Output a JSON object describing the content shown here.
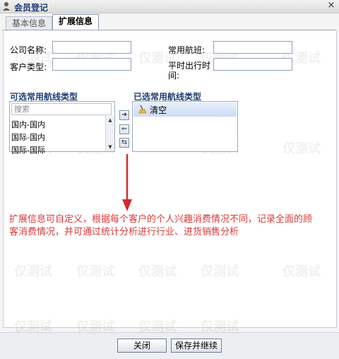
{
  "window": {
    "title": "会员登记",
    "close": "×"
  },
  "tabs": [
    {
      "label": "基本信息"
    },
    {
      "label": "扩展信息"
    }
  ],
  "form": {
    "company_label": "公司名称:",
    "customer_type_label": "客户类型:",
    "route_label": "常用航班:",
    "time_label_1": "平时出行时",
    "time_label_2": "间:",
    "company_value": "",
    "customer_type_value": "",
    "route_value": "",
    "time_value": ""
  },
  "available": {
    "title": "可选常用航线类型",
    "search_placeholder": "搜索",
    "items": [
      "国内-国内",
      "国际-国内",
      "国际-国际"
    ]
  },
  "selected": {
    "title": "已选常用航线类型",
    "items": [
      "清空"
    ]
  },
  "annotation": "扩展信息可自定义，根据每个客户的个人兴趣消费情况不同，记录全面的顾客消费情况，并可通过统计分析进行行业、进货销售分析",
  "buttons": {
    "close": "关闭",
    "save_continue": "保存并继续"
  },
  "watermark_text": "仅测试",
  "colors": {
    "annotation": "#d9393a",
    "arrow": "#d62a2a",
    "title": "#1c3a78"
  },
  "icons": [
    "app-icon",
    "close-icon",
    "move-right-icon",
    "move-left-icon",
    "swap-icon",
    "broom-icon",
    "scroll-up-icon",
    "scroll-down-icon",
    "arrow-down-icon"
  ]
}
